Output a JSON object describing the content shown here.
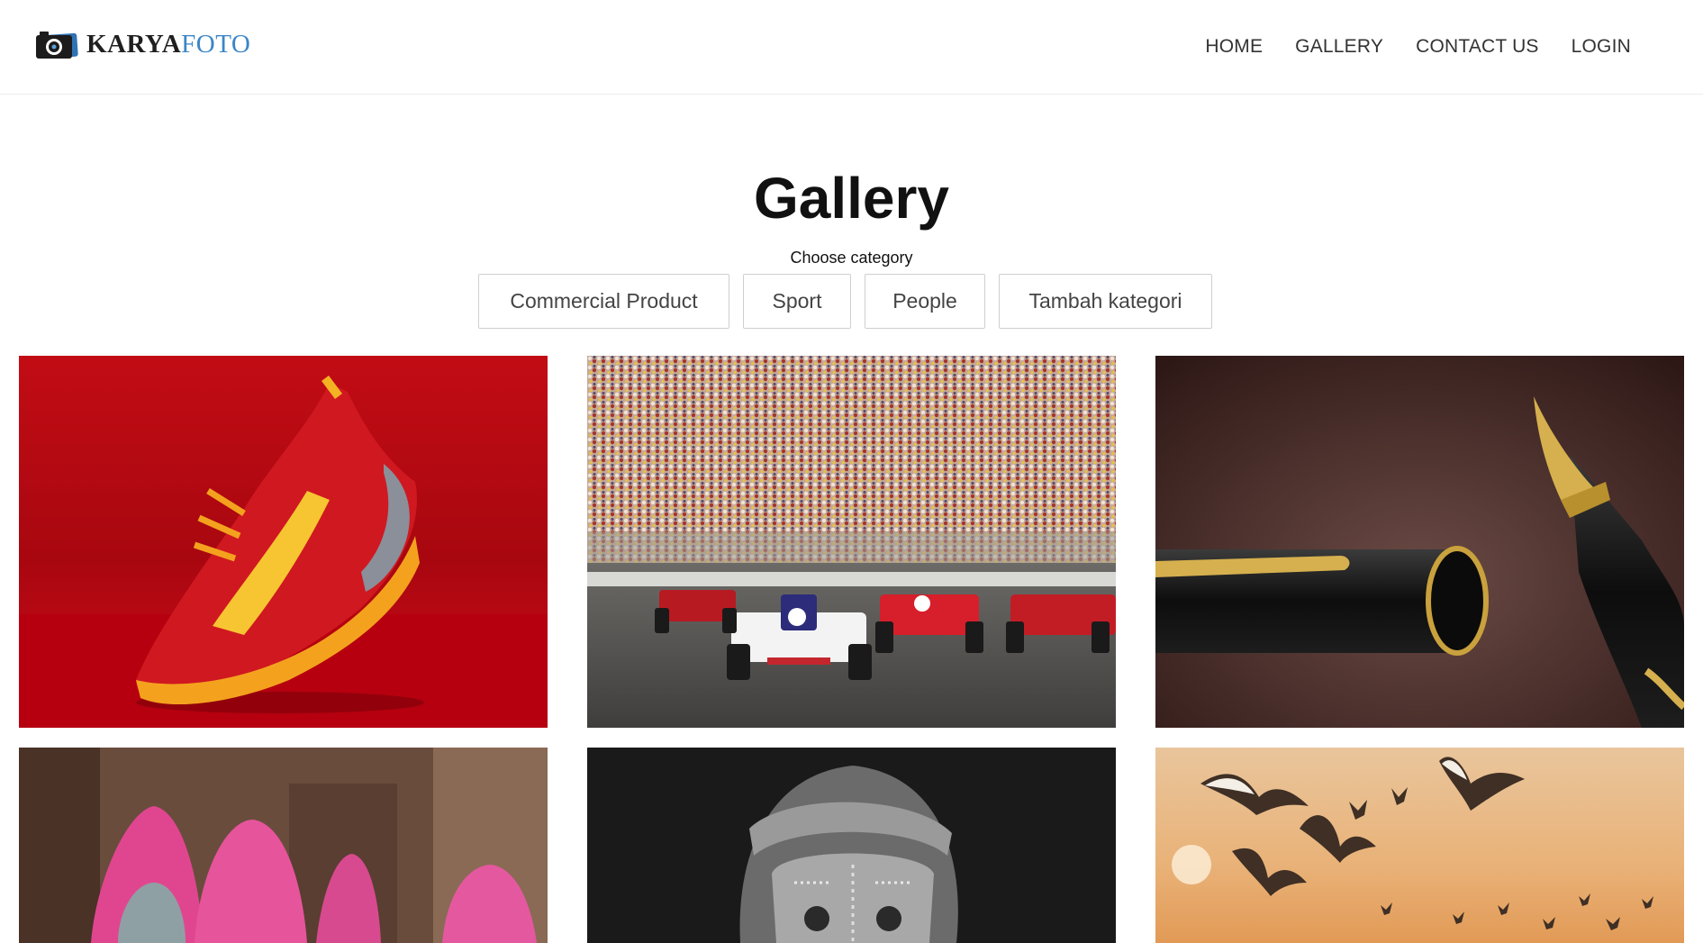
{
  "brand": {
    "name_part1": "KARYA",
    "name_part2": "FOTO"
  },
  "nav": {
    "items": [
      "HOME",
      "GALLERY",
      "CONTACT US",
      "LOGIN"
    ]
  },
  "page": {
    "title": "Gallery",
    "subtitle": "Choose category"
  },
  "categories": [
    "Commercial Product",
    "Sport",
    "People",
    "Tambah kategori"
  ],
  "colors": {
    "brand_accent": "#3b86c6",
    "text_dark": "#111111"
  },
  "gallery": {
    "photos": [
      {
        "subject": "red running shoe"
      },
      {
        "subject": "race cars in front of crowd"
      },
      {
        "subject": "fountain pen"
      },
      {
        "subject": "women in pink saris"
      },
      {
        "subject": "monochrome portrait with turban"
      },
      {
        "subject": "seagulls at sunset"
      }
    ]
  }
}
